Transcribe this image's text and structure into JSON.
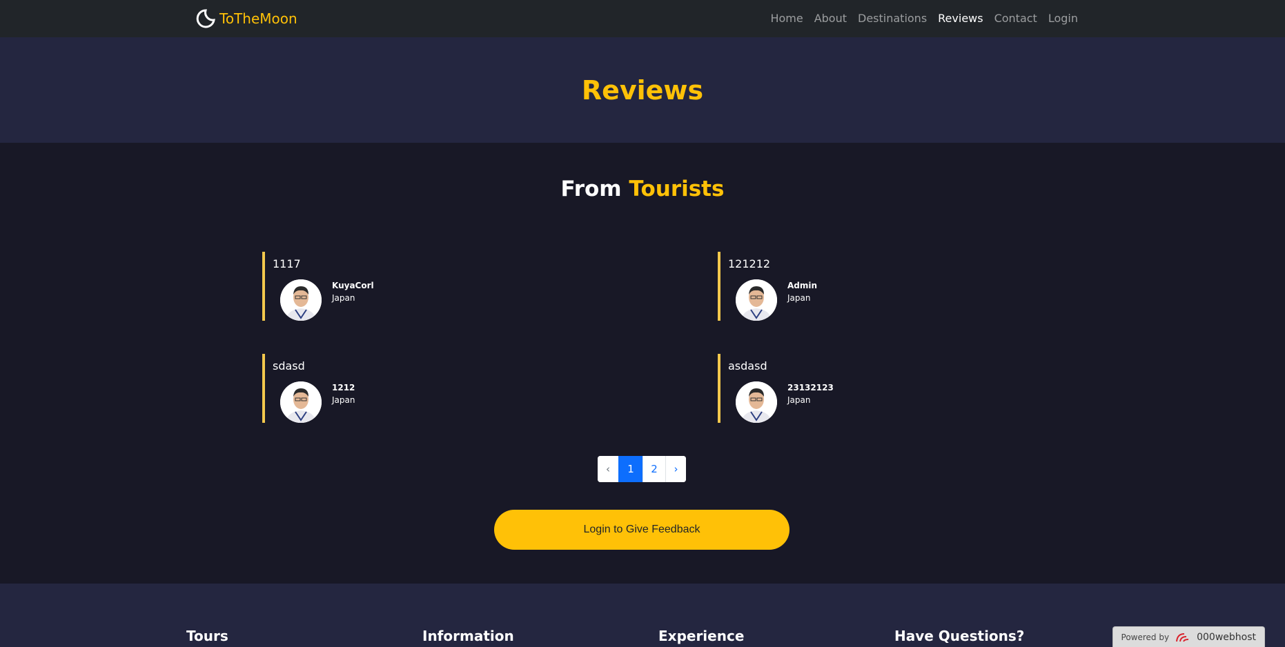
{
  "navbar": {
    "brand": "ToTheMoon",
    "links": [
      "Home",
      "About",
      "Destinations",
      "Reviews",
      "Contact",
      "Login"
    ],
    "active": "Reviews"
  },
  "header": {
    "title": "Reviews"
  },
  "section": {
    "title_prefix": "From",
    "title_accent": "Tourists"
  },
  "reviews": [
    {
      "message": "1117",
      "name": "KuyaCorl",
      "country": "Japan"
    },
    {
      "message": "121212",
      "name": "Admin",
      "country": "Japan"
    },
    {
      "message": "sdasd",
      "name": "1212",
      "country": "Japan"
    },
    {
      "message": "asdasd",
      "name": "23132123",
      "country": "Japan"
    }
  ],
  "pagination": {
    "prev": "‹",
    "pages": [
      "1",
      "2"
    ],
    "current": "1",
    "next": "›"
  },
  "feedback_button": "Login to Give Feedback",
  "footer": {
    "headings": [
      "Tours",
      "Information",
      "Experience",
      "Have Questions?"
    ]
  },
  "hosting_badge": {
    "powered_by": "Powered by",
    "host": "000webhost"
  },
  "colors": {
    "accent": "#ffc107",
    "navbar": "#212529",
    "header_bg": "#242640",
    "body_bg": "#181826",
    "page_active": "#0d6efd"
  }
}
